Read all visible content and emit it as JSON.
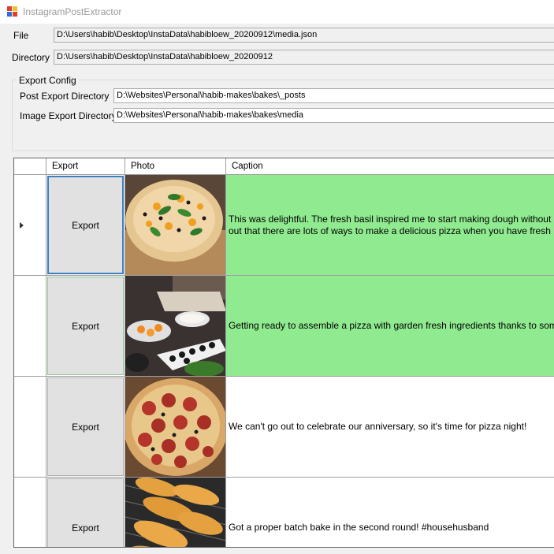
{
  "window": {
    "title": "InstagramPostExtractor"
  },
  "file": {
    "label": "File",
    "value": "D:\\Users\\habib\\Desktop\\InstaData\\habibloew_20200912\\media.json"
  },
  "directory": {
    "label": "Directory",
    "value": "D:\\Users\\habib\\Desktop\\InstaData\\habibloew_20200912"
  },
  "export_config": {
    "title": "Export Config",
    "post_dir_label": "Post Export Directory",
    "post_dir_value": "D:\\Websites\\Personal\\habib-makes\\bakes\\_posts",
    "image_dir_label": "Image Export Directory",
    "image_dir_value": "D:\\Websites\\Personal\\habib-makes\\bakes\\media"
  },
  "grid": {
    "columns": [
      "Export",
      "Photo",
      "Caption"
    ],
    "rows": [
      {
        "button": "Export",
        "caption": "This was delightful. The fresh basil inspired me to start making dough without any though\nout that there are lots of ways to make a delicious pizza when you have fresh ingredients",
        "highlight": "#90ea90",
        "photo": "pizza-basil"
      },
      {
        "button": "Export",
        "caption": "Getting ready to assemble a pizza with garden fresh ingredients thanks to some generou",
        "highlight": "#90ea90",
        "photo": "pizza-ingredients"
      },
      {
        "button": "Export",
        "caption": "We can't go out to celebrate our anniversary, so it's time for pizza night!",
        "highlight": "#ffffff",
        "photo": "pizza-pepperoni"
      },
      {
        "button": "Export",
        "caption": "Got a proper batch bake in the second round! #househusband",
        "highlight": "#ffffff",
        "photo": "bread-rolls"
      }
    ]
  },
  "colors": {
    "selected_row": "#90ea90",
    "focus_border": "#3c7fc0"
  }
}
